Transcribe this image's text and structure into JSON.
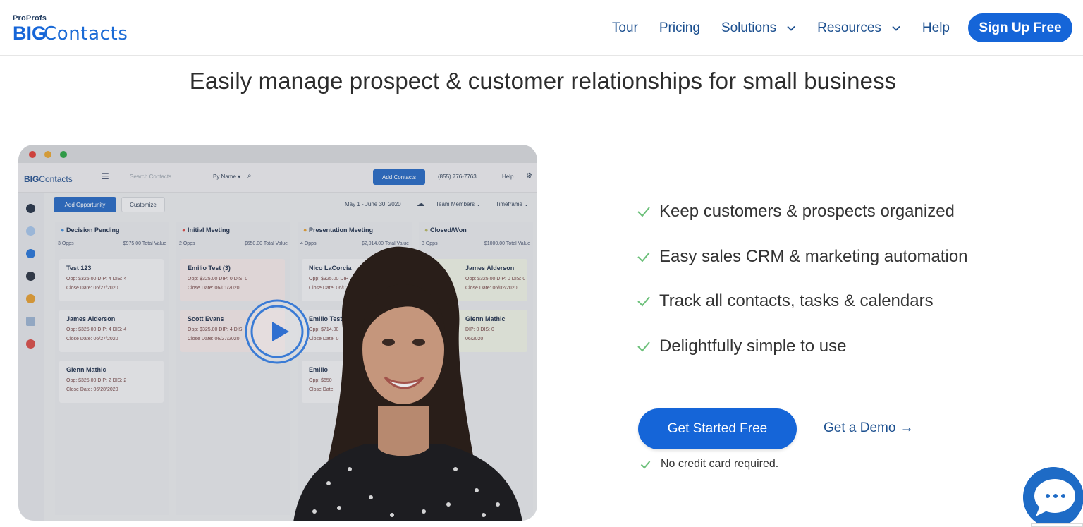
{
  "brand": {
    "small": "ProProfs",
    "big_bold": "BIG",
    "big_light": "Contacts"
  },
  "nav": {
    "items": [
      {
        "label": "Tour",
        "has_dropdown": false
      },
      {
        "label": "Pricing",
        "has_dropdown": false
      },
      {
        "label": "Solutions",
        "has_dropdown": true
      },
      {
        "label": "Resources",
        "has_dropdown": true
      },
      {
        "label": "Help",
        "has_dropdown": false
      }
    ],
    "signup_label": "Sign Up Free"
  },
  "headline": "Easily manage prospect & customer relationships for small business",
  "video": {
    "app": {
      "logo_bold": "BIG",
      "logo_light": "Contacts",
      "search_placeholder": "Search Contacts",
      "search_by": "By Name ▾",
      "add_contacts": "Add Contacts",
      "phone": "(855) 776-7763",
      "help": "Help",
      "add_opportunity": "Add Opportunity",
      "customize": "Customize",
      "date_range": "May 1 - June 30, 2020",
      "team_members": "Team Members ⌄",
      "timeframe": "Timeframe ⌄",
      "columns": [
        {
          "name": "Decision Pending",
          "opps": "3 Opps",
          "total": "$975.00 Total Value",
          "cards": [
            {
              "title": "Test 123",
              "opp": "Opp: $325.00   DIP: 4   DIS: 4",
              "close": "Close Date: 06/27/2020"
            },
            {
              "title": "James Alderson",
              "opp": "Opp: $325.00   DIP: 4   DIS: 4",
              "close": "Close Date: 06/27/2020"
            },
            {
              "title": "Glenn Mathic",
              "opp": "Opp: $325.00   DIP: 2   DIS: 2",
              "close": "Close Date: 06/28/2020"
            }
          ]
        },
        {
          "name": "Initial Meeting",
          "opps": "2 Opps",
          "total": "$650.00 Total Value",
          "cards": [
            {
              "title": "Emilio Test (3)",
              "opp": "Opp: $325.00   DIP: 0   DIS: 0",
              "close": "Close Date: 06/01/2020"
            },
            {
              "title": "Scott Evans",
              "opp": "Opp: $325.00   DIP: 4   DIS: 4",
              "close": "Close Date: 06/27/2020"
            }
          ]
        },
        {
          "name": "Presentation Meeting",
          "opps": "4 Opps",
          "total": "$2,014.00 Total Value",
          "cards": [
            {
              "title": "Nico LaCorcia",
              "opp": "Opp: $325.00   DIP",
              "close": "Close Date: 06/02"
            },
            {
              "title": "Emilio Test",
              "opp": "Opp: $714.00",
              "close": "Close Date: 0"
            },
            {
              "title": "Emilio",
              "opp": "Opp: $650",
              "close": "Close Date"
            }
          ]
        },
        {
          "name": "Closed/Won",
          "opps": "3 Opps",
          "total": "$1000.00 Total Value",
          "cards": [
            {
              "title": "James Alderson",
              "opp": "Opp: $325.00   DIP: 0   DIS: 0",
              "close": "Close Date: 06/02/2020"
            },
            {
              "title": "Glenn Mathic",
              "opp": "DIP: 0   DIS: 0",
              "close": "06/2020"
            }
          ]
        }
      ]
    }
  },
  "features": [
    "Keep customers & prospects organized",
    "Easy sales CRM & marketing automation",
    "Track all contacts, tasks & calendars",
    "Delightfully simple to use"
  ],
  "cta": {
    "primary": "Get Started Free",
    "secondary": "Get a Demo",
    "secondary_arrow": "→",
    "note": "No credit card required."
  },
  "colors": {
    "accent": "#1565d8",
    "link": "#1b4f8f",
    "check": "#6cc07a",
    "chat": "#1e6bc6"
  },
  "icons": [
    "chevron-down-icon",
    "check-icon",
    "play-icon",
    "chat-icon",
    "arrow-right-icon"
  ]
}
